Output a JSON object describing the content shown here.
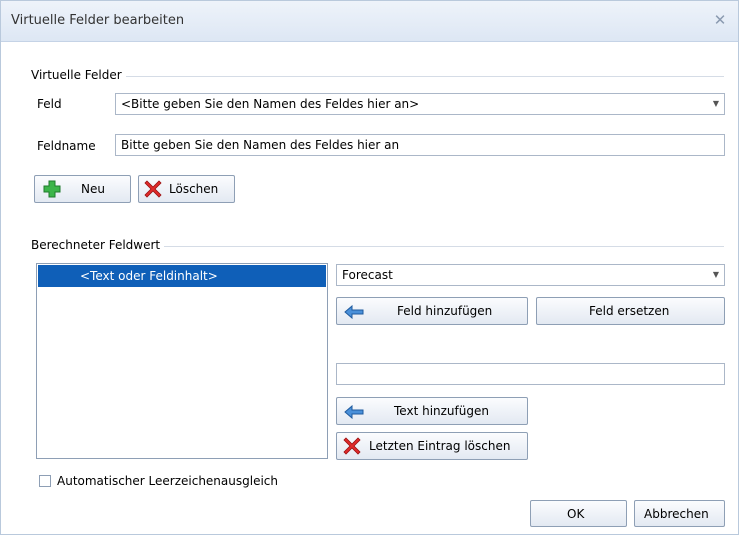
{
  "dialog": {
    "title": "Virtuelle Felder bearbeiten"
  },
  "virtual_fields": {
    "group_label": "Virtuelle Felder",
    "field_label": "Feld",
    "field_value": "<Bitte geben Sie den Namen des Feldes hier an>",
    "fieldname_label": "Feldname",
    "fieldname_value": "Bitte geben Sie den Namen des Feldes hier an",
    "new_label": "Neu",
    "delete_label": "Löschen"
  },
  "computed": {
    "group_label": "Berechneter Feldwert",
    "list_items": [
      "<Text oder Feldinhalt>"
    ],
    "field_select_value": "Forecast",
    "add_field_label": "Feld hinzufügen",
    "replace_field_label": "Feld ersetzen",
    "text_value": "",
    "add_text_label": "Text hinzufügen",
    "delete_last_label": "Letzten Eintrag löschen"
  },
  "options": {
    "auto_space_label": "Automatischer Leerzeichenausgleich",
    "auto_space_checked": false
  },
  "footer": {
    "ok_label": "OK",
    "cancel_label": "Abbrechen"
  },
  "icons": {
    "close": "close-icon",
    "plus": "plus-icon",
    "delete": "red-x-icon",
    "arrow_left": "arrow-left-icon",
    "dropdown": "chevron-down-icon"
  }
}
